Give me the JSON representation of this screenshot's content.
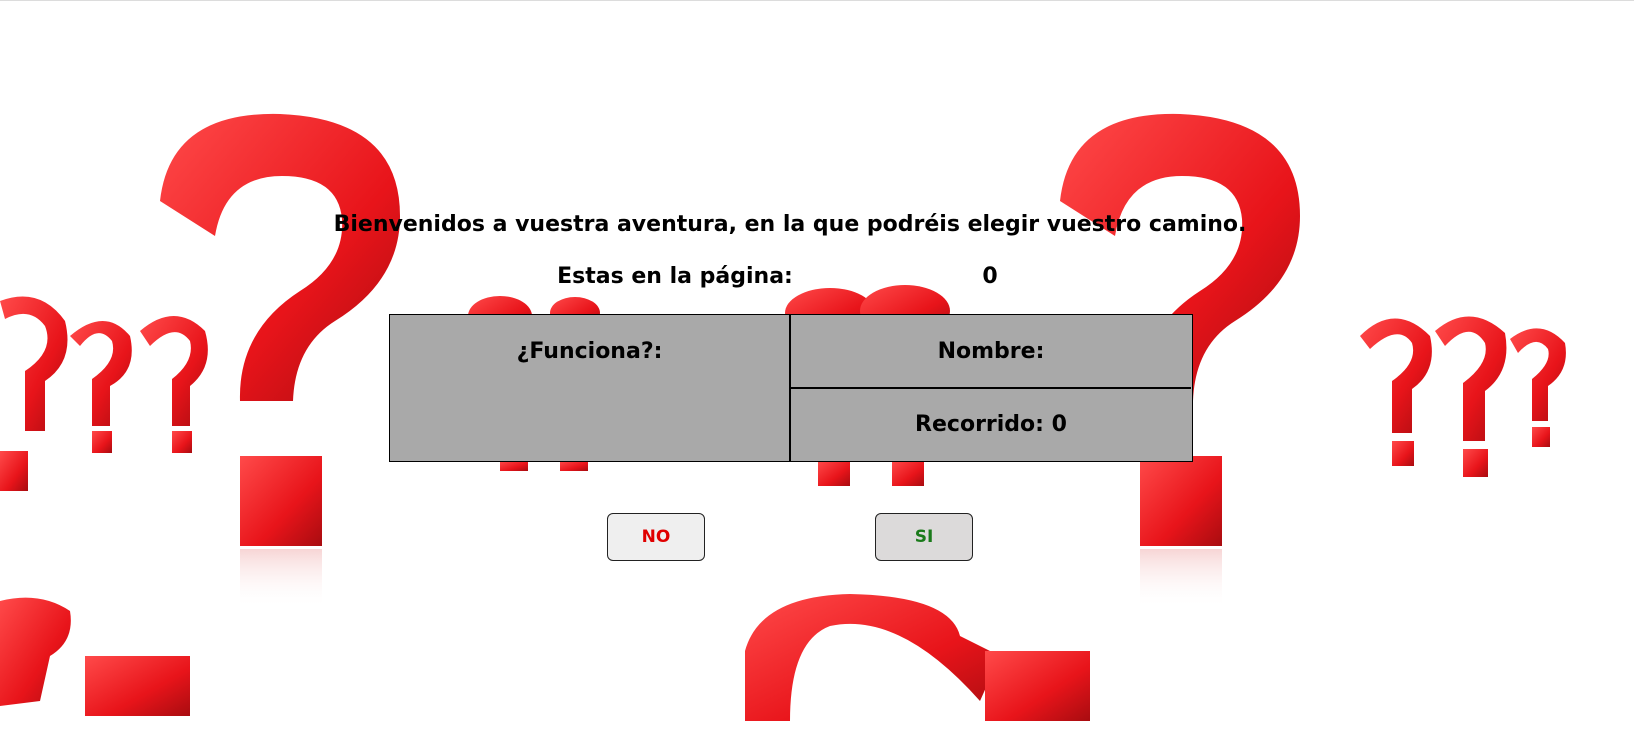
{
  "header": {
    "welcome": "Bienvenidos a vuestra aventura, en la que podréis elegir vuestro camino."
  },
  "page_indicator": {
    "label": "Estas en la página:",
    "value": "0"
  },
  "panel": {
    "works_label": "¿Funciona?:",
    "name_label": "Nombre:",
    "traveled_label": "Recorrido: 0"
  },
  "buttons": {
    "no_label": "NO",
    "yes_label": "SI"
  },
  "colors": {
    "accent_red": "#e00000",
    "accent_green": "#1a7a1a",
    "panel_bg": "#a9a9a9",
    "decor_red": "#e8141a"
  },
  "icons": {
    "background": "question-mark-icon"
  }
}
